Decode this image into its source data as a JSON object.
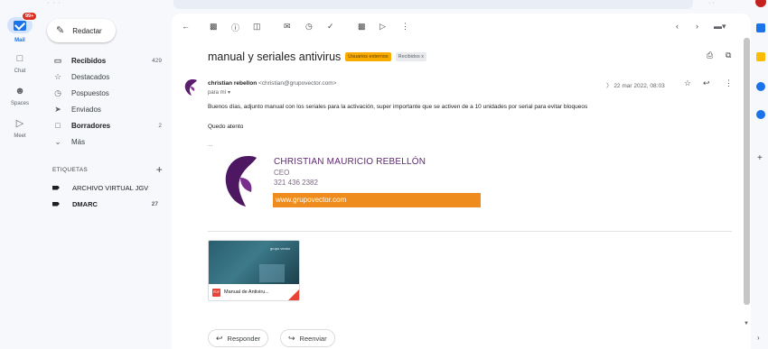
{
  "rail": {
    "mail_badge": "99+",
    "mail_label": "Mail",
    "chat_label": "Chat",
    "spaces_label": "Spaces",
    "meet_label": "Meet"
  },
  "compose": {
    "label": "Redactar"
  },
  "nav": {
    "items": [
      {
        "label": "Recibidos",
        "count": "429",
        "icon": "inbox-icon"
      },
      {
        "label": "Destacados",
        "count": "",
        "icon": "star-icon"
      },
      {
        "label": "Pospuestos",
        "count": "",
        "icon": "clock-icon"
      },
      {
        "label": "Enviados",
        "count": "",
        "icon": "send-icon"
      },
      {
        "label": "Borradores",
        "count": "2",
        "icon": "draft-icon"
      },
      {
        "label": "Más",
        "count": "",
        "icon": "chevron-down-icon"
      }
    ]
  },
  "labels": {
    "heading": "ETIQUETAS",
    "items": [
      {
        "label": "ARCHIVO VIRTUAL JGV",
        "count": ""
      },
      {
        "label": "DMARC",
        "count": "27"
      }
    ]
  },
  "email": {
    "subject": "manual y seriales antivirus",
    "chip_external": "Usuarios externos",
    "chip_inbox": "Recibidos x",
    "sender_name": "christian rebellon",
    "sender_email": "<christian@grupovector.com>",
    "to": "para mí",
    "date": "22 mar 2022, 08:03",
    "body": [
      "Buenos días, adjunto manual con los seriales para la activación, super importante que se activen de a 10 unidades por serial para evitar bloqueos",
      "Quedo atento",
      "..."
    ],
    "signature": {
      "name": "CHRISTIAN MAURICIO REBELLÓN",
      "role": "CEO",
      "phone": "321 436 2382",
      "website": "www.grupovector.com"
    },
    "attachment": {
      "name": "Manual de Antiviru...",
      "type_label": "PDF",
      "brand": "grupo vector"
    },
    "reply_label": "Responder",
    "forward_label": "Reenviar"
  },
  "colors": {
    "accent": "#1a73e8",
    "chip_external": "#f9ab00",
    "signature_bar": "#ef8c1e",
    "brand_purple": "#5c2a6e"
  }
}
